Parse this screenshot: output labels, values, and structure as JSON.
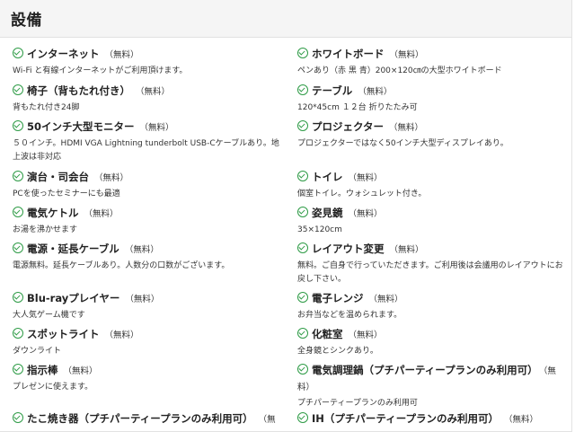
{
  "section": {
    "title": "設備"
  },
  "left_items": [
    {
      "name": "インターネット",
      "badge": "（無料）",
      "desc": "Wi-Fi と有線インターネットがご利用頂けます。"
    },
    {
      "name": "椅子（背もたれ付き）",
      "badge": "（無料）",
      "desc": "背もたれ付き24脚"
    },
    {
      "name": "50インチ大型モニター",
      "badge": "（無料）",
      "desc": "５０インチ。HDMI VGA Lightning tunderbolt USB-Cケーブルあり。地上波は非対応"
    },
    {
      "name": "演台・司会台",
      "badge": "（無料）",
      "desc": "PCを使ったセミナーにも最適"
    },
    {
      "name": "電気ケトル",
      "badge": "（無料）",
      "desc": "お湯を沸かせます"
    },
    {
      "name": "電源・延長ケーブル",
      "badge": "（無料）",
      "desc": "電源無料。延長ケーブルあり。人数分の口数がございます。"
    },
    {
      "name": "Blu-rayプレイヤー",
      "badge": "（無料）",
      "desc": "大人気ゲーム機です"
    },
    {
      "name": "スポットライト",
      "badge": "（無料）",
      "desc": "ダウンライト"
    },
    {
      "name": "指示棒",
      "badge": "（無料）",
      "desc": "プレゼンに使えます。"
    },
    {
      "name": "たこ焼き器（プチパーティープランのみ利用可）",
      "badge": "（無",
      "desc": ""
    }
  ],
  "right_items": [
    {
      "name": "ホワイトボード",
      "badge": "（無料）",
      "desc": "ペンあり（赤 黒 青）200×120㎝の大型ホワイトボード"
    },
    {
      "name": "テーブル",
      "badge": "（無料）",
      "desc": "120*45cm １２台 折りたたみ可"
    },
    {
      "name": "プロジェクター",
      "badge": "（無料）",
      "desc": "プロジェクターではなく50インチ大型ディスプレイあり。"
    },
    {
      "name": "トイレ",
      "badge": "（無料）",
      "desc": "個室トイレ。ウォシュレット付き。"
    },
    {
      "name": "姿見鏡",
      "badge": "（無料）",
      "desc": "35×120cm"
    },
    {
      "name": "レイアウト変更",
      "badge": "（無料）",
      "desc": "無料。ご自身で行っていただきます。ご利用後は会議用のレイアウトにお戻し下さい。"
    },
    {
      "name": "電子レンジ",
      "badge": "（無料）",
      "desc": "お弁当などを温められます。"
    },
    {
      "name": "化粧室",
      "badge": "（無料）",
      "desc": "全身鏡とシンクあり。"
    },
    {
      "name": "電気調理鍋（プチパーティープランのみ利用可）",
      "badge": "（無料）",
      "desc": "プチパーティープランのみ利用可"
    },
    {
      "name": "IH（プチパーティープランのみ利用可）",
      "badge": "（無料）",
      "desc": ""
    }
  ]
}
